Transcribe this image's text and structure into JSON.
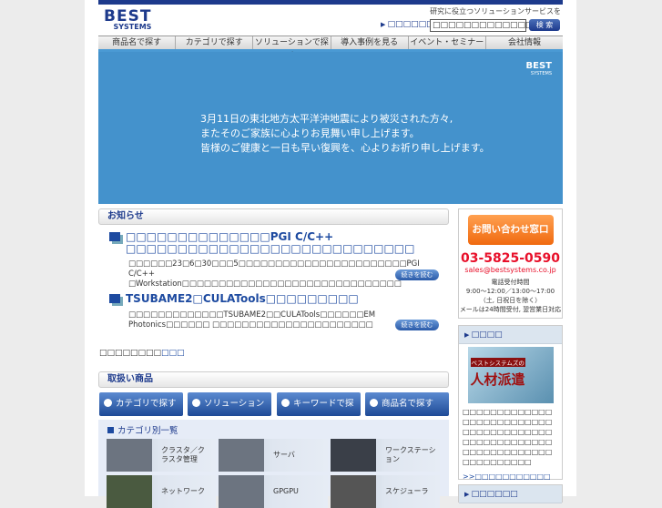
{
  "header": {
    "logo": "BEST",
    "logo_sub": "SYSTEMS",
    "tagline": "研究に役立つソリューションサービスを",
    "quick_link": "□□□□□□",
    "search_value": "□□□□□□□□□□□□□",
    "search_button": "検 索"
  },
  "nav": [
    "商品名で探す",
    "カテゴリで探す",
    "ソリューションで探す",
    "導入事例を見る",
    "イベント・セミナー",
    "会社情報"
  ],
  "banner": {
    "lines": [
      "3月11日の東北地方太平洋沖地震により被災された方々,",
      "またそのご家族に心よりお見舞い申し上げます。",
      "皆様のご健康と一日も早い復興を、心よりお祈り申し上げます。"
    ],
    "logo": "BEST",
    "logo_sub": "SYSTEMS"
  },
  "news": {
    "title": "お知らせ",
    "items": [
      {
        "title": "□□□□□□□□□□□□□□PGI C/C++ □□□□□□□□□□□□□□□□□□□□□□□□□□□□",
        "body": "□□□□□□23□6□30□□□5□□□□□□□□□□□□□□□□□□□□□□□PGI C/C++ □Workstation□□□□□□□□□□□□□□□□□□□□□□□□□□□□□□",
        "more": "続きを読む"
      },
      {
        "title": "TSUBAME2□CULATools□□□□□□□□□",
        "body": "□□□□□□□□□□□□□TSUBAME2□□CULATools□□□□□□EM Photonics□□□□□□ □□□□□□□□□□□□□□□□□□□□□□",
        "more": "続きを読む"
      }
    ],
    "past_prefix": "□□□□□□□□",
    "past_link": "□□□"
  },
  "products": {
    "title": "取扱い商品",
    "buttons": [
      "カテゴリで探す",
      "ソリューションで探す",
      "キーワードで探す",
      "商品名で探す"
    ],
    "category_title": "カテゴリ別一覧",
    "categories": [
      "クラスタ／クラスタ管理",
      "サーバ",
      "ワークステーション",
      "ネットワーク",
      "GPGPU",
      "スケジューラ"
    ]
  },
  "contact": {
    "button": "お問い合わせ窓口",
    "phone": "03-5825-0590",
    "email": "sales@bestsystems.co.jp",
    "hours_title": "電話受付時間",
    "hours": "9:00〜12:00／13:00〜17:00",
    "closed": "（土, 日祝日を除く）",
    "mail_note": "メールは24時間受付, 翌営業日対応"
  },
  "recruit": {
    "title": "□□□□",
    "image_text1": "ベストシステムズの",
    "image_text2": "人材派遣",
    "body": "□□□□□□□□□□□□□□□□□□□□□□□□□□□□□□□□□□□□□□□□□□□□□□□□□□□□□□□□□□□□□□□□□□□□□□□□□□□",
    "link": ">>□□□□□□□□□□□"
  },
  "next_box": {
    "title": "□□□□□□"
  }
}
